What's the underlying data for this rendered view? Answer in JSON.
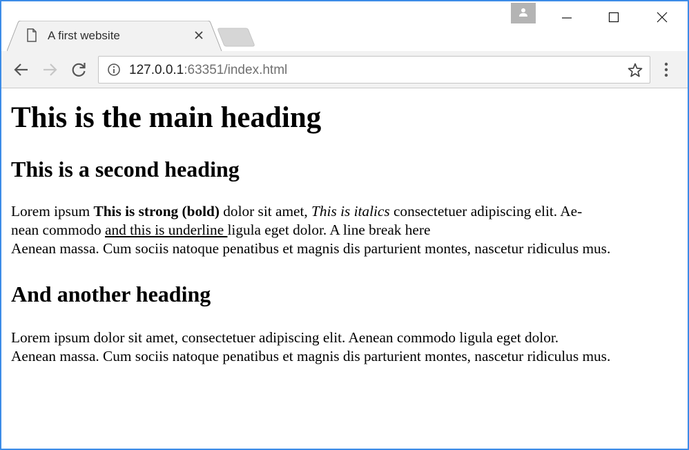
{
  "window": {
    "tab_title": "A first website"
  },
  "toolbar": {
    "url_host": "127.0.0.1",
    "url_rest": ":63351/index.html"
  },
  "page": {
    "h1": "This is the main heading",
    "h2_first": "This is a second heading",
    "p1": {
      "t1": "Lorem ipsum ",
      "strong": "This is strong (bold)",
      "t2": " dolor sit amet, ",
      "em": "This is italics",
      "t3": " consectetuer adipiscing elit. Ae-",
      "t3b": "nean commodo ",
      "underline": "and this is underline ",
      "t4": "ligula eget dolor. A line break here",
      "after_break": "Aenean massa. Cum sociis natoque penatibus et magnis dis parturient montes, nascetur ridiculus mus."
    },
    "h2_second": "And another heading",
    "p2": {
      "line1": "Lorem ipsum dolor sit amet, consectetuer adipiscing elit. Aenean commodo ligula eget dolor.",
      "line2": "Aenean massa. Cum sociis natoque penatibus et magnis dis parturient montes, nascetur ridiculus mus."
    }
  },
  "colors": {
    "window_border": "#3c8ce7",
    "toolbar_bg": "#f2f2f2",
    "url_host": "#202020",
    "url_rest": "#707070"
  },
  "icons": [
    "page-icon",
    "close-icon",
    "new-tab-icon",
    "profile-icon",
    "minimize-icon",
    "maximize-icon",
    "window-close-icon",
    "back-icon",
    "forward-icon",
    "reload-icon",
    "info-icon",
    "star-icon",
    "menu-icon"
  ]
}
